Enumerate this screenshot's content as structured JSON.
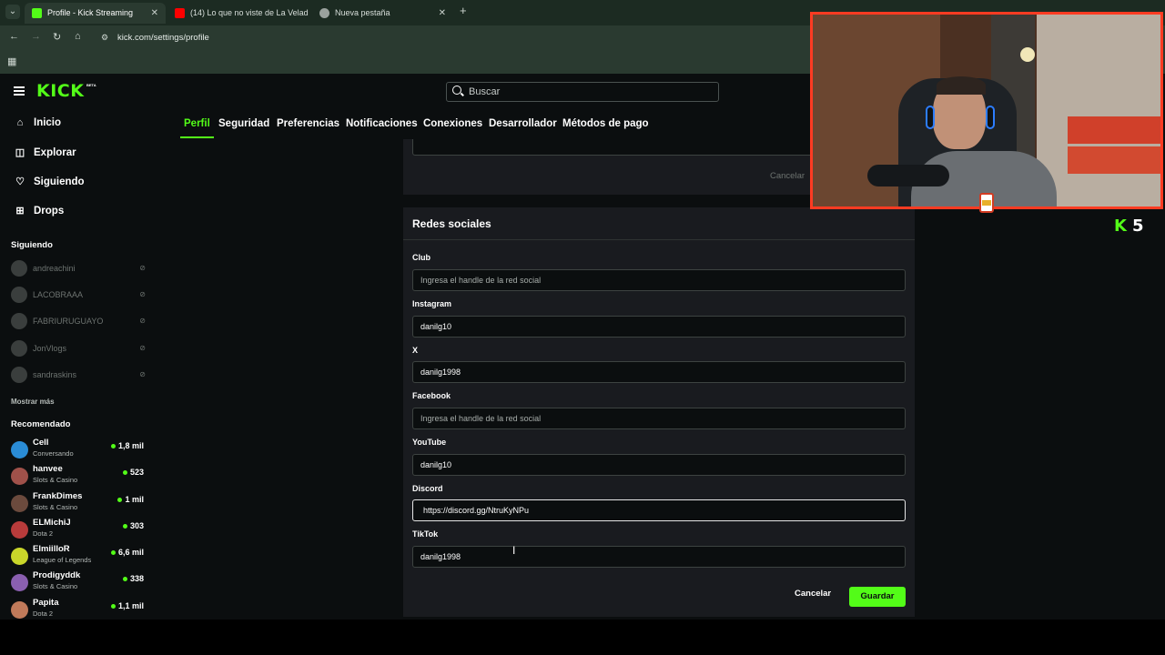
{
  "browser": {
    "tabs": [
      {
        "title": "Profile - Kick Streaming",
        "color": "#53fc18"
      },
      {
        "title": "(14) Lo que no viste de La Velad",
        "color": "#ff0000"
      },
      {
        "title": "Nueva pestaña",
        "color": "#9aa19d"
      }
    ],
    "url": "kick.com/settings/profile"
  },
  "header": {
    "logo": "KICK",
    "logo_badge": "BETA",
    "search_placeholder": "Buscar"
  },
  "sidebar": {
    "nav": [
      {
        "label": "Inicio",
        "icon": "home-icon"
      },
      {
        "label": "Explorar",
        "icon": "compass-icon"
      },
      {
        "label": "Siguiendo",
        "icon": "heart-icon"
      },
      {
        "label": "Drops",
        "icon": "gift-icon"
      }
    ],
    "following_heading": "Siguiendo",
    "following": [
      {
        "name": "andreachini"
      },
      {
        "name": "LACOBRAAA"
      },
      {
        "name": "FABRIURUGUAYO"
      },
      {
        "name": "JonVlogs"
      },
      {
        "name": "sandraskins"
      }
    ],
    "show_more": "Mostrar más",
    "recommended_heading": "Recomendado",
    "recommended": [
      {
        "name": "Cell",
        "category": "Conversando",
        "viewers": "1,8 mil",
        "avatar_color": "#2a8cd6"
      },
      {
        "name": "hanvee",
        "category": "Slots & Casino",
        "viewers": "523",
        "avatar_color": "#a0514a"
      },
      {
        "name": "FrankDimes",
        "category": "Slots & Casino",
        "viewers": "1 mil",
        "avatar_color": "#6b4a3d"
      },
      {
        "name": "ELMichiJ",
        "category": "Dota 2",
        "viewers": "303",
        "avatar_color": "#b83b3b"
      },
      {
        "name": "ElmiilloR",
        "category": "League of Legends",
        "viewers": "6,6 mil",
        "avatar_color": "#c9d62a"
      },
      {
        "name": "Prodigyddk",
        "category": "Slots & Casino",
        "viewers": "338",
        "avatar_color": "#8a5fb0"
      },
      {
        "name": "Papita",
        "category": "Dota 2",
        "viewers": "1,1 mil",
        "avatar_color": "#c07a5a"
      }
    ]
  },
  "settings_tabs": [
    "Perfil",
    "Seguridad",
    "Preferencias",
    "Notificaciones",
    "Conexiones",
    "Desarrollador",
    "Métodos de pago"
  ],
  "previous_panel": {
    "cancel_label": "Cancelar"
  },
  "social": {
    "title": "Redes sociales",
    "fields": [
      {
        "label": "Club",
        "value": "",
        "placeholder": "Ingresa el handle de la red social"
      },
      {
        "label": "Instagram",
        "value": "danilg10",
        "placeholder": "Ingresa el handle de la red social"
      },
      {
        "label": "X",
        "value": "danilg1998",
        "placeholder": "Ingresa el handle de la red social"
      },
      {
        "label": "Facebook",
        "value": "",
        "placeholder": "Ingresa el handle de la red social"
      },
      {
        "label": "YouTube",
        "value": "danilg10",
        "placeholder": "Ingresa el handle de la red social"
      },
      {
        "label": "Discord",
        "value": "https://discord.gg/NtruKyNPu",
        "placeholder": "Ingresa el handle de la red social"
      },
      {
        "label": "TikTok",
        "value": "danilg1998",
        "placeholder": "Ingresa el handle de la red social"
      }
    ],
    "cancel_label": "Cancelar",
    "save_label": "Guardar"
  },
  "stream_overlay": {
    "logo_k": "K",
    "logo_number": "5"
  },
  "colors": {
    "accent": "#53fc18",
    "background": "#0b0e0f",
    "panel": "#191b1f",
    "webcam_border": "#ff3b22"
  }
}
